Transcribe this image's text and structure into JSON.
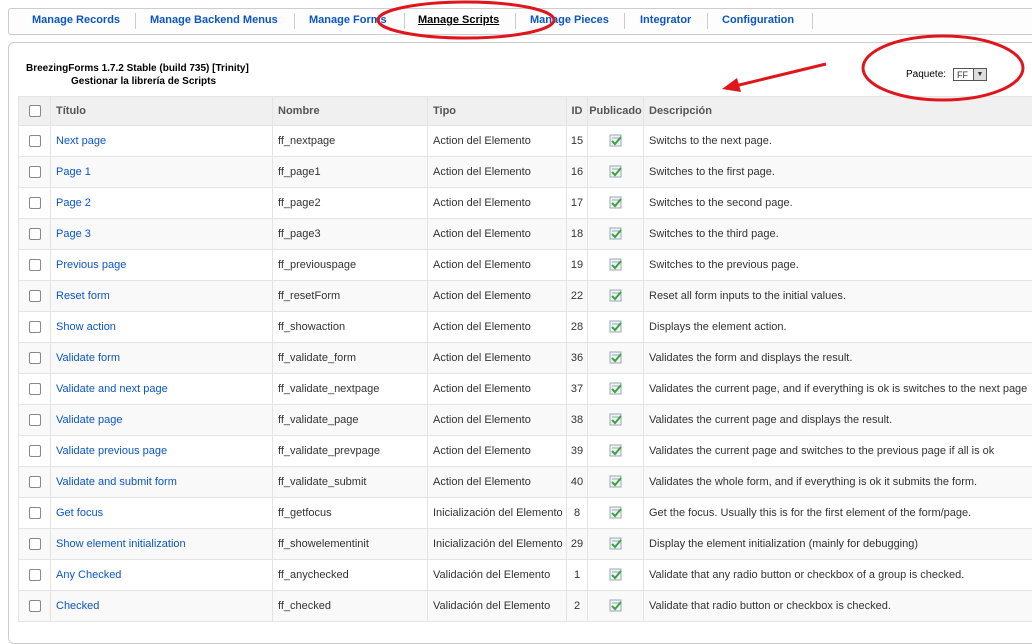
{
  "menu": {
    "items": [
      {
        "label": "Manage Records",
        "active": false
      },
      {
        "label": "Manage Backend Menus",
        "active": false
      },
      {
        "label": "Manage Forms",
        "active": false
      },
      {
        "label": "Manage Scripts",
        "active": true
      },
      {
        "label": "Manage Pieces",
        "active": false
      },
      {
        "label": "Integrator",
        "active": false
      },
      {
        "label": "Configuration",
        "active": false
      }
    ]
  },
  "header": {
    "title": "BreezingForms 1.7.2 Stable (build 735) [Trinity]",
    "subtitle": "Gestionar la librería de Scripts"
  },
  "package": {
    "label": "Paquete:",
    "selected": "FF"
  },
  "table": {
    "columns": {
      "titulo": "Título",
      "nombre": "Nombre",
      "tipo": "Tipo",
      "id": "ID",
      "publicado": "Publicado",
      "descripcion": "Descripción"
    },
    "rows": [
      {
        "titulo": "Next page",
        "nombre": "ff_nextpage",
        "tipo": "Action del Elemento",
        "id": "15",
        "descripcion": "Switchs to the next page."
      },
      {
        "titulo": "Page 1",
        "nombre": "ff_page1",
        "tipo": "Action del Elemento",
        "id": "16",
        "descripcion": "Switches to the first page."
      },
      {
        "titulo": "Page 2",
        "nombre": "ff_page2",
        "tipo": "Action del Elemento",
        "id": "17",
        "descripcion": "Switches to the second page."
      },
      {
        "titulo": "Page 3",
        "nombre": "ff_page3",
        "tipo": "Action del Elemento",
        "id": "18",
        "descripcion": "Switches to the third page."
      },
      {
        "titulo": "Previous page",
        "nombre": "ff_previouspage",
        "tipo": "Action del Elemento",
        "id": "19",
        "descripcion": "Switches to the previous page."
      },
      {
        "titulo": "Reset form",
        "nombre": "ff_resetForm",
        "tipo": "Action del Elemento",
        "id": "22",
        "descripcion": "Reset all form inputs to the initial values."
      },
      {
        "titulo": "Show action",
        "nombre": "ff_showaction",
        "tipo": "Action del Elemento",
        "id": "28",
        "descripcion": "Displays the element action."
      },
      {
        "titulo": "Validate form",
        "nombre": "ff_validate_form",
        "tipo": "Action del Elemento",
        "id": "36",
        "descripcion": "Validates the form and displays the result."
      },
      {
        "titulo": "Validate and next page",
        "nombre": "ff_validate_nextpage",
        "tipo": "Action del Elemento",
        "id": "37",
        "descripcion": "Validates the current page, and if everything is ok is switches to the next page"
      },
      {
        "titulo": "Validate page",
        "nombre": "ff_validate_page",
        "tipo": "Action del Elemento",
        "id": "38",
        "descripcion": "Validates the current page and displays the result."
      },
      {
        "titulo": "Validate previous page",
        "nombre": "ff_validate_prevpage",
        "tipo": "Action del Elemento",
        "id": "39",
        "descripcion": "Validates the current page and switches to the previous page if all is ok"
      },
      {
        "titulo": "Validate and submit form",
        "nombre": "ff_validate_submit",
        "tipo": "Action del Elemento",
        "id": "40",
        "descripcion": "Validates the whole form, and if everything is ok it submits the form."
      },
      {
        "titulo": "Get focus",
        "nombre": "ff_getfocus",
        "tipo": "Inicialización del Elemento",
        "id": "8",
        "descripcion": "Get the focus. Usually this is for the first element of the form/page."
      },
      {
        "titulo": "Show element initialization",
        "nombre": "ff_showelementinit",
        "tipo": "Inicialización del Elemento",
        "id": "29",
        "descripcion": "Display the element initialization (mainly for debugging)"
      },
      {
        "titulo": "Any Checked",
        "nombre": "ff_anychecked",
        "tipo": "Validación del Elemento",
        "id": "1",
        "descripcion": "Validate that any radio button or checkbox of a group is checked."
      },
      {
        "titulo": "Checked",
        "nombre": "ff_checked",
        "tipo": "Validación del Elemento",
        "id": "2",
        "descripcion": "Validate that radio button or checkbox is checked."
      }
    ]
  },
  "colors": {
    "link": "#0b55c4",
    "annotation": "#e0161d",
    "published": "#3ea13e"
  },
  "icons": {
    "published": "published-check-icon",
    "dropdown": "dropdown-arrow-icon"
  }
}
